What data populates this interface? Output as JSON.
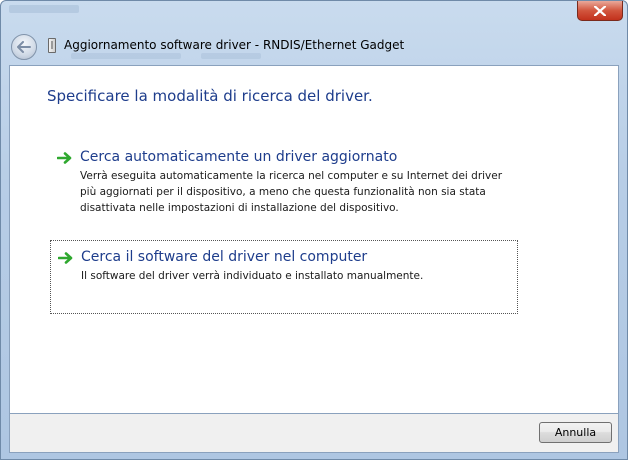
{
  "window": {
    "title": "Aggiornamento software driver - RNDIS/Ethernet Gadget",
    "accent": "#1e3d8c"
  },
  "content": {
    "heading": "Specificare la modalità di ricerca del driver.",
    "options": [
      {
        "title": "Cerca automaticamente un driver aggiornato",
        "description": "Verrà eseguita automaticamente la ricerca nel computer e su Internet dei driver più aggiornati per il dispositivo, a meno che questa funzionalità non sia stata disattivata nelle impostazioni di installazione del dispositivo.",
        "icon": "green-arrow-icon"
      },
      {
        "title": "Cerca il software del driver nel computer",
        "description": "Il software del driver verrà individuato e installato manualmente.",
        "icon": "green-arrow-icon"
      }
    ]
  },
  "footer": {
    "cancel_label": "Annulla"
  }
}
